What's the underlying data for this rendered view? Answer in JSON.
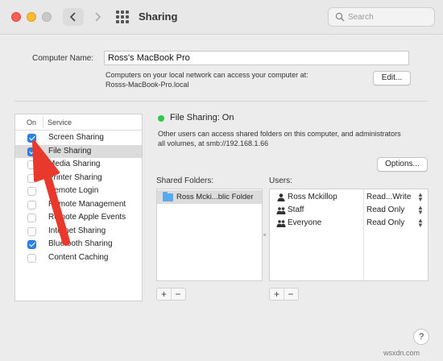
{
  "window": {
    "title": "Sharing"
  },
  "search": {
    "placeholder": "Search"
  },
  "computer_name": {
    "label": "Computer Name:",
    "value": "Ross's MacBook Pro",
    "info_line1": "Computers on your local network can access your computer at:",
    "info_line2": "Rosss-MacBook-Pro.local",
    "edit_label": "Edit..."
  },
  "services": {
    "header_on": "On",
    "header_service": "Service",
    "items": [
      {
        "label": "Screen Sharing",
        "checked": true
      },
      {
        "label": "File Sharing",
        "checked": true,
        "selected": true
      },
      {
        "label": "Media Sharing",
        "checked": false
      },
      {
        "label": "Printer Sharing",
        "checked": false
      },
      {
        "label": "Remote Login",
        "checked": false
      },
      {
        "label": "Remote Management",
        "checked": false
      },
      {
        "label": "Remote Apple Events",
        "checked": false
      },
      {
        "label": "Internet Sharing",
        "checked": false
      },
      {
        "label": "Bluetooth Sharing",
        "checked": true
      },
      {
        "label": "Content Caching",
        "checked": false
      }
    ]
  },
  "file_sharing": {
    "status": "File Sharing: On",
    "status_color": "#2ec942",
    "description_line1": "Other users can access shared folders on this computer, and administrators",
    "description_line2": "all volumes, at smb://192.168.1.66",
    "options_label": "Options...",
    "shared_folders_label": "Shared Folders:",
    "users_label": "Users:",
    "folders": [
      {
        "label": "Ross Mcki...blic Folder",
        "icon": "folder-icon"
      }
    ],
    "users": [
      {
        "name": "Ross Mckillop",
        "permission": "Read...Write",
        "icon": "person-icon"
      },
      {
        "name": "Staff",
        "permission": "Read Only",
        "icon": "group-icon"
      },
      {
        "name": "Everyone",
        "permission": "Read Only",
        "icon": "group-icon"
      }
    ],
    "add_symbol": "+",
    "remove_symbol": "−"
  },
  "help": {
    "label": "?"
  },
  "watermark": "wsxdn.com",
  "accent_color": "#2f80ed",
  "annotation_color": "#e8392c"
}
